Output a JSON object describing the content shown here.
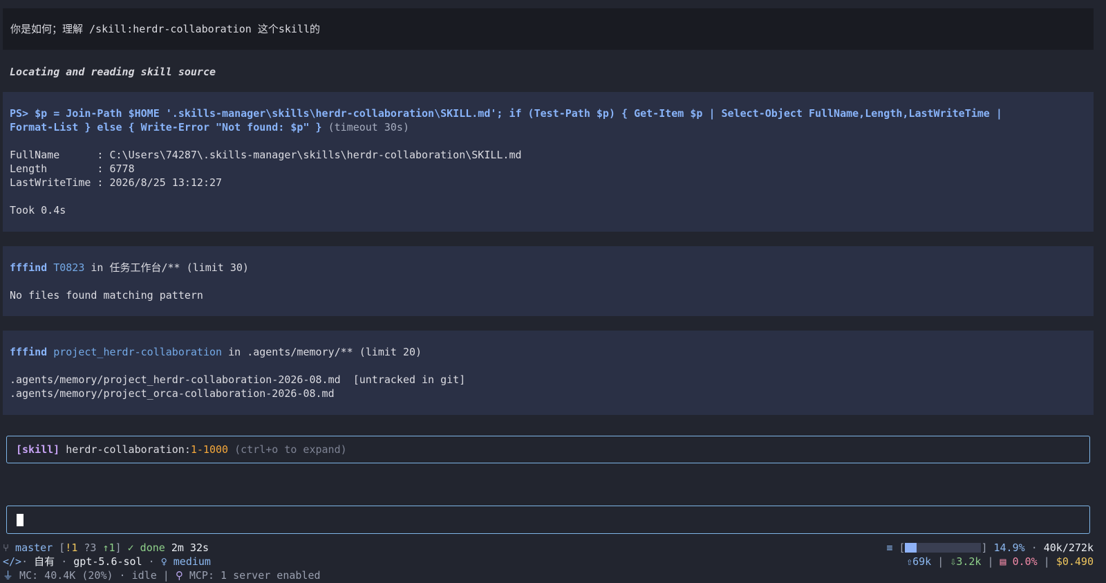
{
  "prompt": {
    "text": "你是如何；理解 /skill:herdr-collaboration 这个skill的"
  },
  "status": {
    "text": "Locating and reading skill source"
  },
  "block1": {
    "cmd_line1": "PS> $p = Join-Path $HOME '.skills-manager\\skills\\herdr-collaboration\\SKILL.md'; if (Test-Path $p) { Get-Item $p | Select-Object FullName,Length,LastWriteTime |",
    "cmd_line2": "Format-List } else { Write-Error \"Not found: $p\" }",
    "timeout": "(timeout 30s)",
    "out1": "FullName      : C:\\Users\\74287\\.skills-manager\\skills\\herdr-collaboration\\SKILL.md",
    "out2": "Length        : 6778",
    "out3": "LastWriteTime : 2026/8/25 13:12:27",
    "took": "Took 0.4s"
  },
  "block2": {
    "tool": "fffind",
    "pattern": "T0823",
    "in": "in",
    "path": "任务工作台/**",
    "limit": "(limit 30)",
    "result": "No files found matching pattern"
  },
  "block3": {
    "tool": "fffind",
    "pattern": "project_herdr-collaboration",
    "in": "in",
    "path": ".agents/memory/**",
    "limit": "(limit 20)",
    "result1": ".agents/memory/project_herdr-collaboration-2026-08.md  [untracked in git]",
    "result2": ".agents/memory/project_orca-collaboration-2026-08.md"
  },
  "skill": {
    "tag": "[skill]",
    "name": "herdr-collaboration",
    "colon": ":",
    "range": "1-1000",
    "hint": "(ctrl+o to expand)"
  },
  "statusbar": {
    "branch": "master",
    "git_open": "[",
    "git_mod": "!1",
    "git_untracked": "?3",
    "git_ahead": "↑1",
    "git_close": "]",
    "done_label": "done",
    "elapsed": "2m 32s",
    "owner": "自有",
    "model": "gpt-5.6-sol",
    "effort": "medium",
    "mc": "MC: 40.4K (20%)",
    "idle": "idle",
    "mcp": "MCP: 1 server enabled",
    "context_percent": "14.9%",
    "context_fill": 0.149,
    "context_tokens": "40k/272k",
    "tokens_up": "69k",
    "tokens_down": "3.2k",
    "cache": "0.0%",
    "cost": "$0.490",
    "sep_dot": "·",
    "sep_bar": "|"
  },
  "colors": {
    "accent": "#89b4fa",
    "border": "#7fb6e8",
    "block_bg": "#2a3045"
  }
}
